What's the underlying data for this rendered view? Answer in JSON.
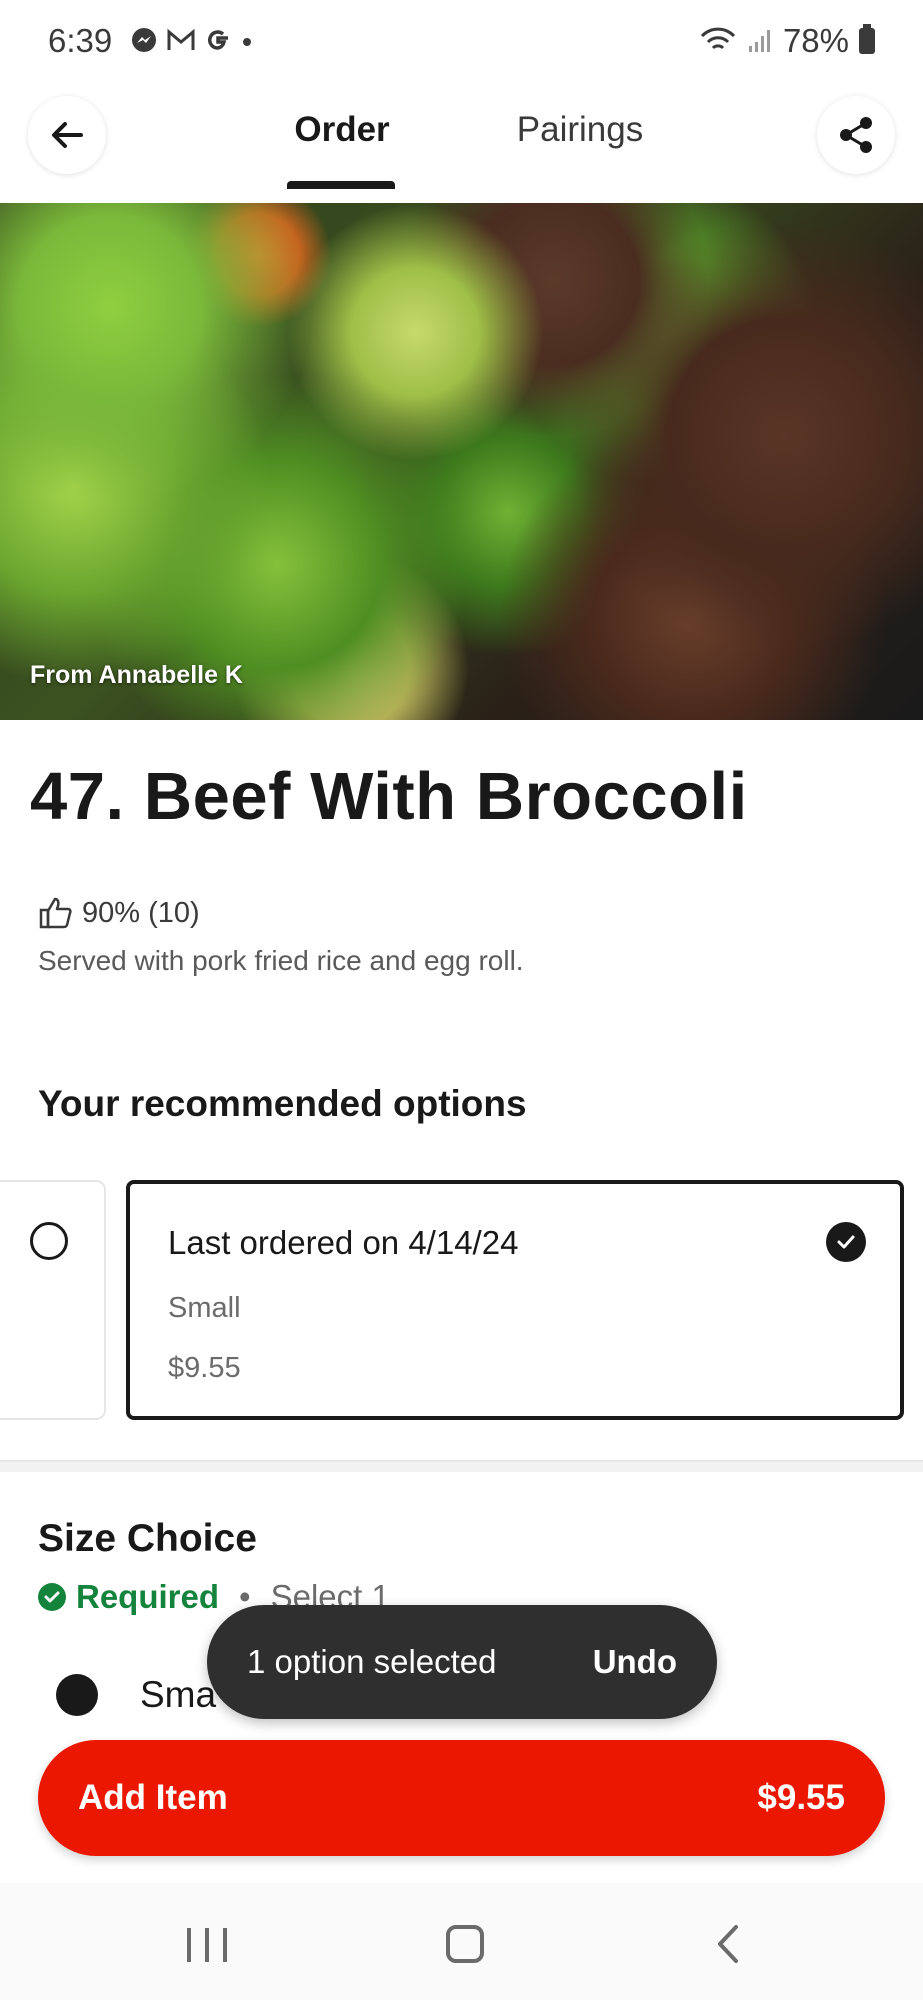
{
  "status_bar": {
    "time": "6:39",
    "notif_icons": [
      "messenger-icon",
      "gmail-icon",
      "google-icon",
      "dot-icon"
    ],
    "battery": "78%"
  },
  "nav": {
    "tabs": [
      {
        "label": "Order",
        "active": true
      },
      {
        "label": "Pairings",
        "active": false
      }
    ]
  },
  "hero": {
    "caption": "From Annabelle K"
  },
  "item": {
    "title": "47. Beef With Broccoli",
    "rating": "90% (10)",
    "description": "Served with pork fried rice and egg roll."
  },
  "recommended": {
    "title": "Your recommended options",
    "selected_card": {
      "line1": "Last ordered on 4/14/24",
      "line2": "Small",
      "line3": "$9.55"
    }
  },
  "size_choice": {
    "title": "Size Choice",
    "required": "Required",
    "select": "Select 1",
    "option_visible": "Sma"
  },
  "snackbar": {
    "text": "1 option selected",
    "action": "Undo"
  },
  "add_item": {
    "label": "Add Item",
    "price": "$9.55"
  },
  "colors": {
    "brand_red": "#eb1700",
    "required_green": "#14843d",
    "text_dark": "#191919"
  }
}
